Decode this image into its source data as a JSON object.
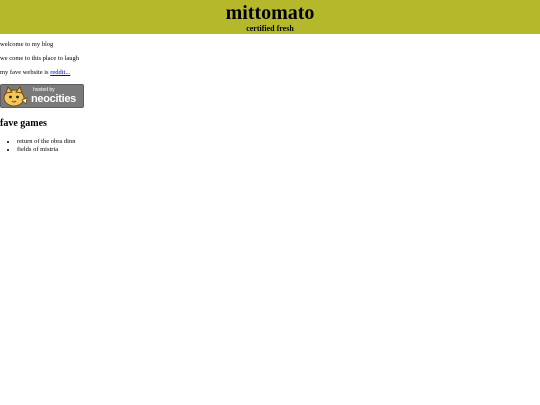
{
  "header": {
    "title": "mittomato",
    "tagline": "certified fresh"
  },
  "intro": {
    "line1": "welcome to my blog",
    "line2": "we come to this place to laugh",
    "line3_prefix": "my fave website is ",
    "line3_link": "reddit..."
  },
  "badge": {
    "hosted_text": "hosted by",
    "brand_text": "neocities",
    "icon": "neocities-cat-icon"
  },
  "games": {
    "heading": "fave games",
    "items": [
      "return of the obra dinn",
      "fields of mistria"
    ]
  }
}
